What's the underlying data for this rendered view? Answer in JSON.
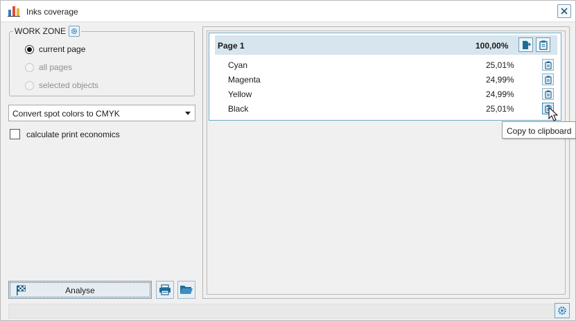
{
  "window": {
    "title": "Inks coverage",
    "app_icon": "bar-chart-icon",
    "close_icon": "close-icon"
  },
  "work_zone": {
    "legend": "WORK ZONE",
    "legend_icon": "gear-icon",
    "options": [
      {
        "label": "current page",
        "selected": true,
        "enabled": true
      },
      {
        "label": "all pages",
        "selected": false,
        "enabled": false
      },
      {
        "label": "selected objects",
        "selected": false,
        "enabled": false
      }
    ]
  },
  "conversion": {
    "selected": "Convert spot colors to CMYK"
  },
  "print_economics": {
    "label": "calculate print economics",
    "checked": false
  },
  "actions": {
    "analyse_label": "Analyse",
    "analyse_icon": "checkered-flag-icon",
    "print_icon": "printer-icon",
    "open_icon": "folder-open-icon"
  },
  "results": {
    "page": {
      "title": "Page 1",
      "total": "100,00%",
      "export_icon": "export-icon",
      "copy_icon": "clipboard-icon"
    },
    "inks": [
      {
        "name": "Cyan",
        "coverage": "25,01%"
      },
      {
        "name": "Magenta",
        "coverage": "24,99%"
      },
      {
        "name": "Yellow",
        "coverage": "24,99%"
      },
      {
        "name": "Black",
        "coverage": "25,01%"
      }
    ]
  },
  "tooltip": {
    "text": "Copy to clipboard"
  },
  "status": {
    "settings_icon": "gear-icon"
  },
  "colors": {
    "accent": "#3e87b0",
    "header_bg": "#d6e5ee",
    "card_border": "#6aa9c4"
  }
}
